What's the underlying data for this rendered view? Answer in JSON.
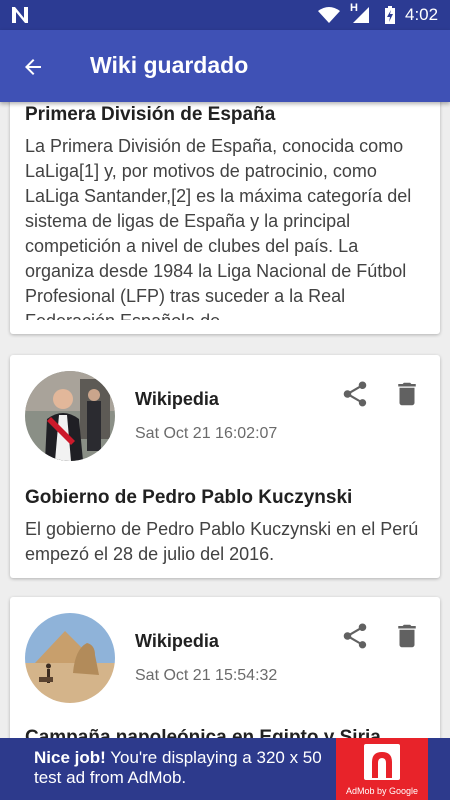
{
  "status_bar": {
    "time": "4:02",
    "network_type": "H",
    "icons": [
      "app-logo-icon",
      "wifi-icon",
      "signal-icon",
      "battery-icon"
    ]
  },
  "app_bar": {
    "title": "Wiki guardado",
    "back_icon": "arrow-back-icon"
  },
  "cards": [
    {
      "title": "Primera División de España",
      "body": "La Primera División de España, conocida como LaLiga[1] y, por motivos de patrocinio, como LaLiga Santander,[2] es la máxima categoría del sistema de ligas de España y la principal competición a nivel de clubes del país. La organiza desde 1984 la Liga Nacional de Fútbol Profesional (LFP) tras suceder a la Real Federación Española de"
    },
    {
      "source": "Wikipedia",
      "date": "Sat Oct 21 16:02:07",
      "title": "Gobierno de Pedro Pablo Kuczynski",
      "body": "El gobierno de Pedro Pablo Kuczynski en el Perú empezó el 28 de julio del 2016.",
      "icons": [
        "share-icon",
        "delete-icon"
      ]
    },
    {
      "source": "Wikipedia",
      "date": "Sat Oct 21 15:54:32",
      "title": "Campaña napoleónica en Egipto y Siria",
      "icons": [
        "share-icon",
        "delete-icon"
      ]
    }
  ],
  "ad": {
    "headline": "Nice job!",
    "text": " You're displaying a 320 x 50 test ad from AdMob.",
    "attribution": "AdMob by Google"
  },
  "colors": {
    "status_bar": "#2c3b93",
    "app_bar": "#3f51b5",
    "background": "#eeeeee",
    "ad_banner": "#2d3a8c",
    "ad_logo": "#e8232a",
    "icon_gray": "#616161"
  }
}
